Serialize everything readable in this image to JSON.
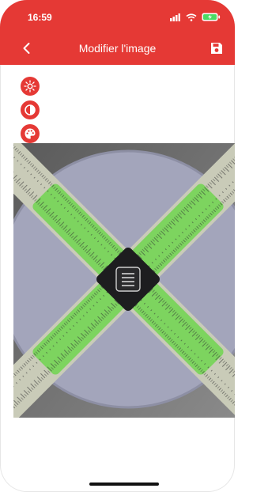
{
  "status": {
    "time": "16:59"
  },
  "header": {
    "title": "Modifier l'image"
  },
  "tools": [
    {
      "icon": "brightness-icon"
    },
    {
      "icon": "contrast-icon"
    },
    {
      "icon": "palette-icon"
    }
  ],
  "colors": {
    "accent": "#e53935"
  }
}
